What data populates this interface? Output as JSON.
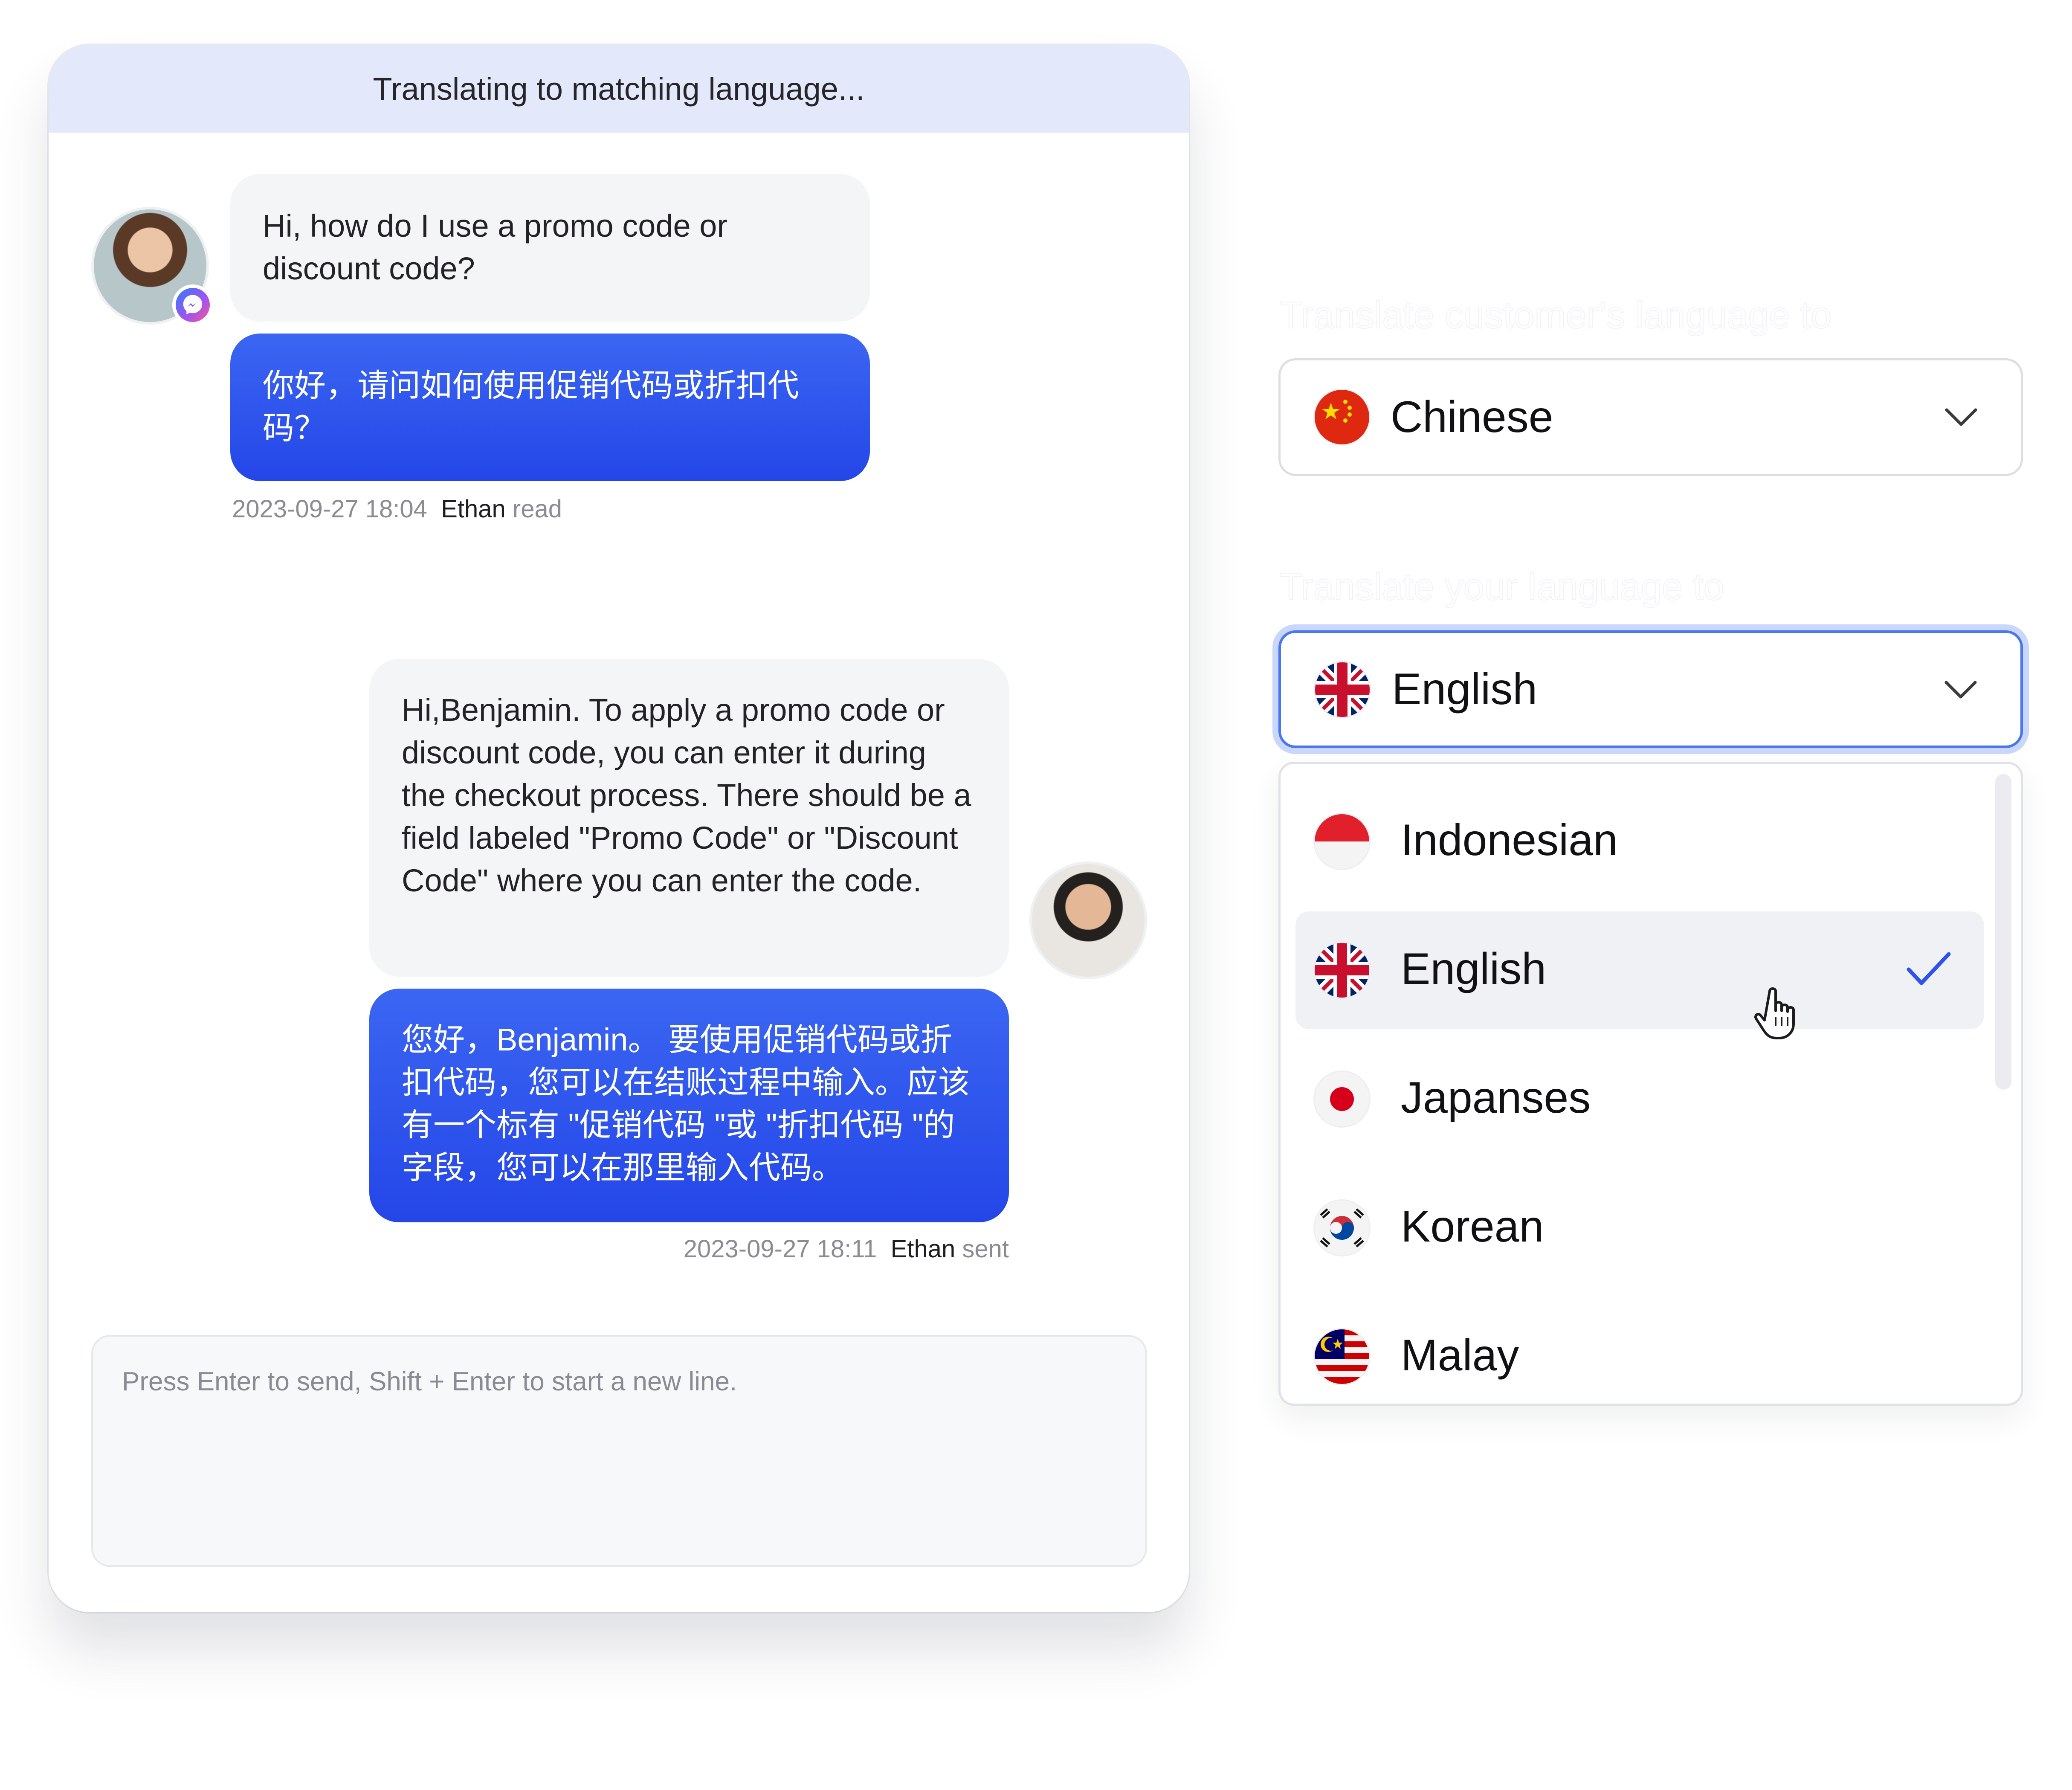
{
  "chat": {
    "banner": "Translating to matching language...",
    "messages": [
      {
        "original": "Hi, how do I use a promo code or discount code?",
        "translated": "你好，请问如何使用促销代码或折扣代码？",
        "timestamp": "2023-09-27 18:04",
        "agent": "Ethan",
        "status": "read"
      },
      {
        "original": "Hi,Benjamin. To apply a promo code or discount code, you can enter it during the checkout process. There should be a field labeled \"Promo Code\" or \"Discount Code\" where you can enter the code.",
        "translated": "您好，Benjamin。 要使用促销代码或折扣代码，您可以在结账过程中输入。应该有一个标有 \"促销代码 \"或 \"折扣代码 \"的字段，您可以在那里输入代码。",
        "timestamp": "2023-09-27 18:11",
        "agent": "Ethan",
        "status": "sent"
      }
    ],
    "input_placeholder": "Press Enter to send,  Shift + Enter to start a new line."
  },
  "translation": {
    "customer_label": "Translate customer's language to",
    "customer_selected": "Chinese",
    "your_label": "Translate your language to",
    "your_selected": "English",
    "options": [
      {
        "label": "Indonesian",
        "flag": "indonesia-flag"
      },
      {
        "label": "English",
        "flag": "uk-flag",
        "selected": true
      },
      {
        "label": "Japanses",
        "flag": "japan-flag"
      },
      {
        "label": "Korean",
        "flag": "korea-flag"
      },
      {
        "label": "Malay",
        "flag": "malaysia-flag"
      }
    ]
  },
  "colors": {
    "accent": "#2d52ee",
    "banner_bg": "#e3e8fb",
    "focus_ring": "#4a76f0",
    "bubble_gray": "#f4f5f7"
  }
}
